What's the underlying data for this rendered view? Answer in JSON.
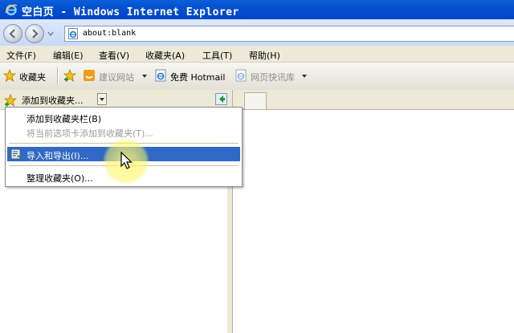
{
  "window": {
    "title": "空白页 - Windows Internet Explorer",
    "icon": "ie-logo-icon"
  },
  "address_bar": {
    "url": "about:blank",
    "back_icon": "back-arrow-icon",
    "forward_icon": "forward-arrow-icon",
    "page_icon": "ie-page-icon"
  },
  "menu": {
    "items": [
      "文件(F)",
      "编辑(E)",
      "查看(V)",
      "收藏夹(A)",
      "工具(T)",
      "帮助(H)"
    ]
  },
  "links_bar": {
    "favorites_label": "收藏夹",
    "suggested_sites": "建议网站",
    "free_hotmail": "免费 Hotmail",
    "web_slice_gallery": "网页快讯库"
  },
  "favorites_pane": {
    "add_to_favorites": "添加到收藏夹..."
  },
  "dropdown": {
    "items": [
      {
        "label": "添加到收藏夹栏(B)",
        "disabled": false
      },
      {
        "label": "将当前选项卡添加到收藏夹(T)...",
        "disabled": true
      },
      {
        "label": "导入和导出(I)...",
        "disabled": false,
        "highlighted": true
      },
      {
        "label": "整理收藏夹(O)...",
        "disabled": false
      }
    ]
  },
  "colors": {
    "titlebar": "#0550cf",
    "highlight": "#316ac5",
    "cursor_halo": "#fff578"
  }
}
